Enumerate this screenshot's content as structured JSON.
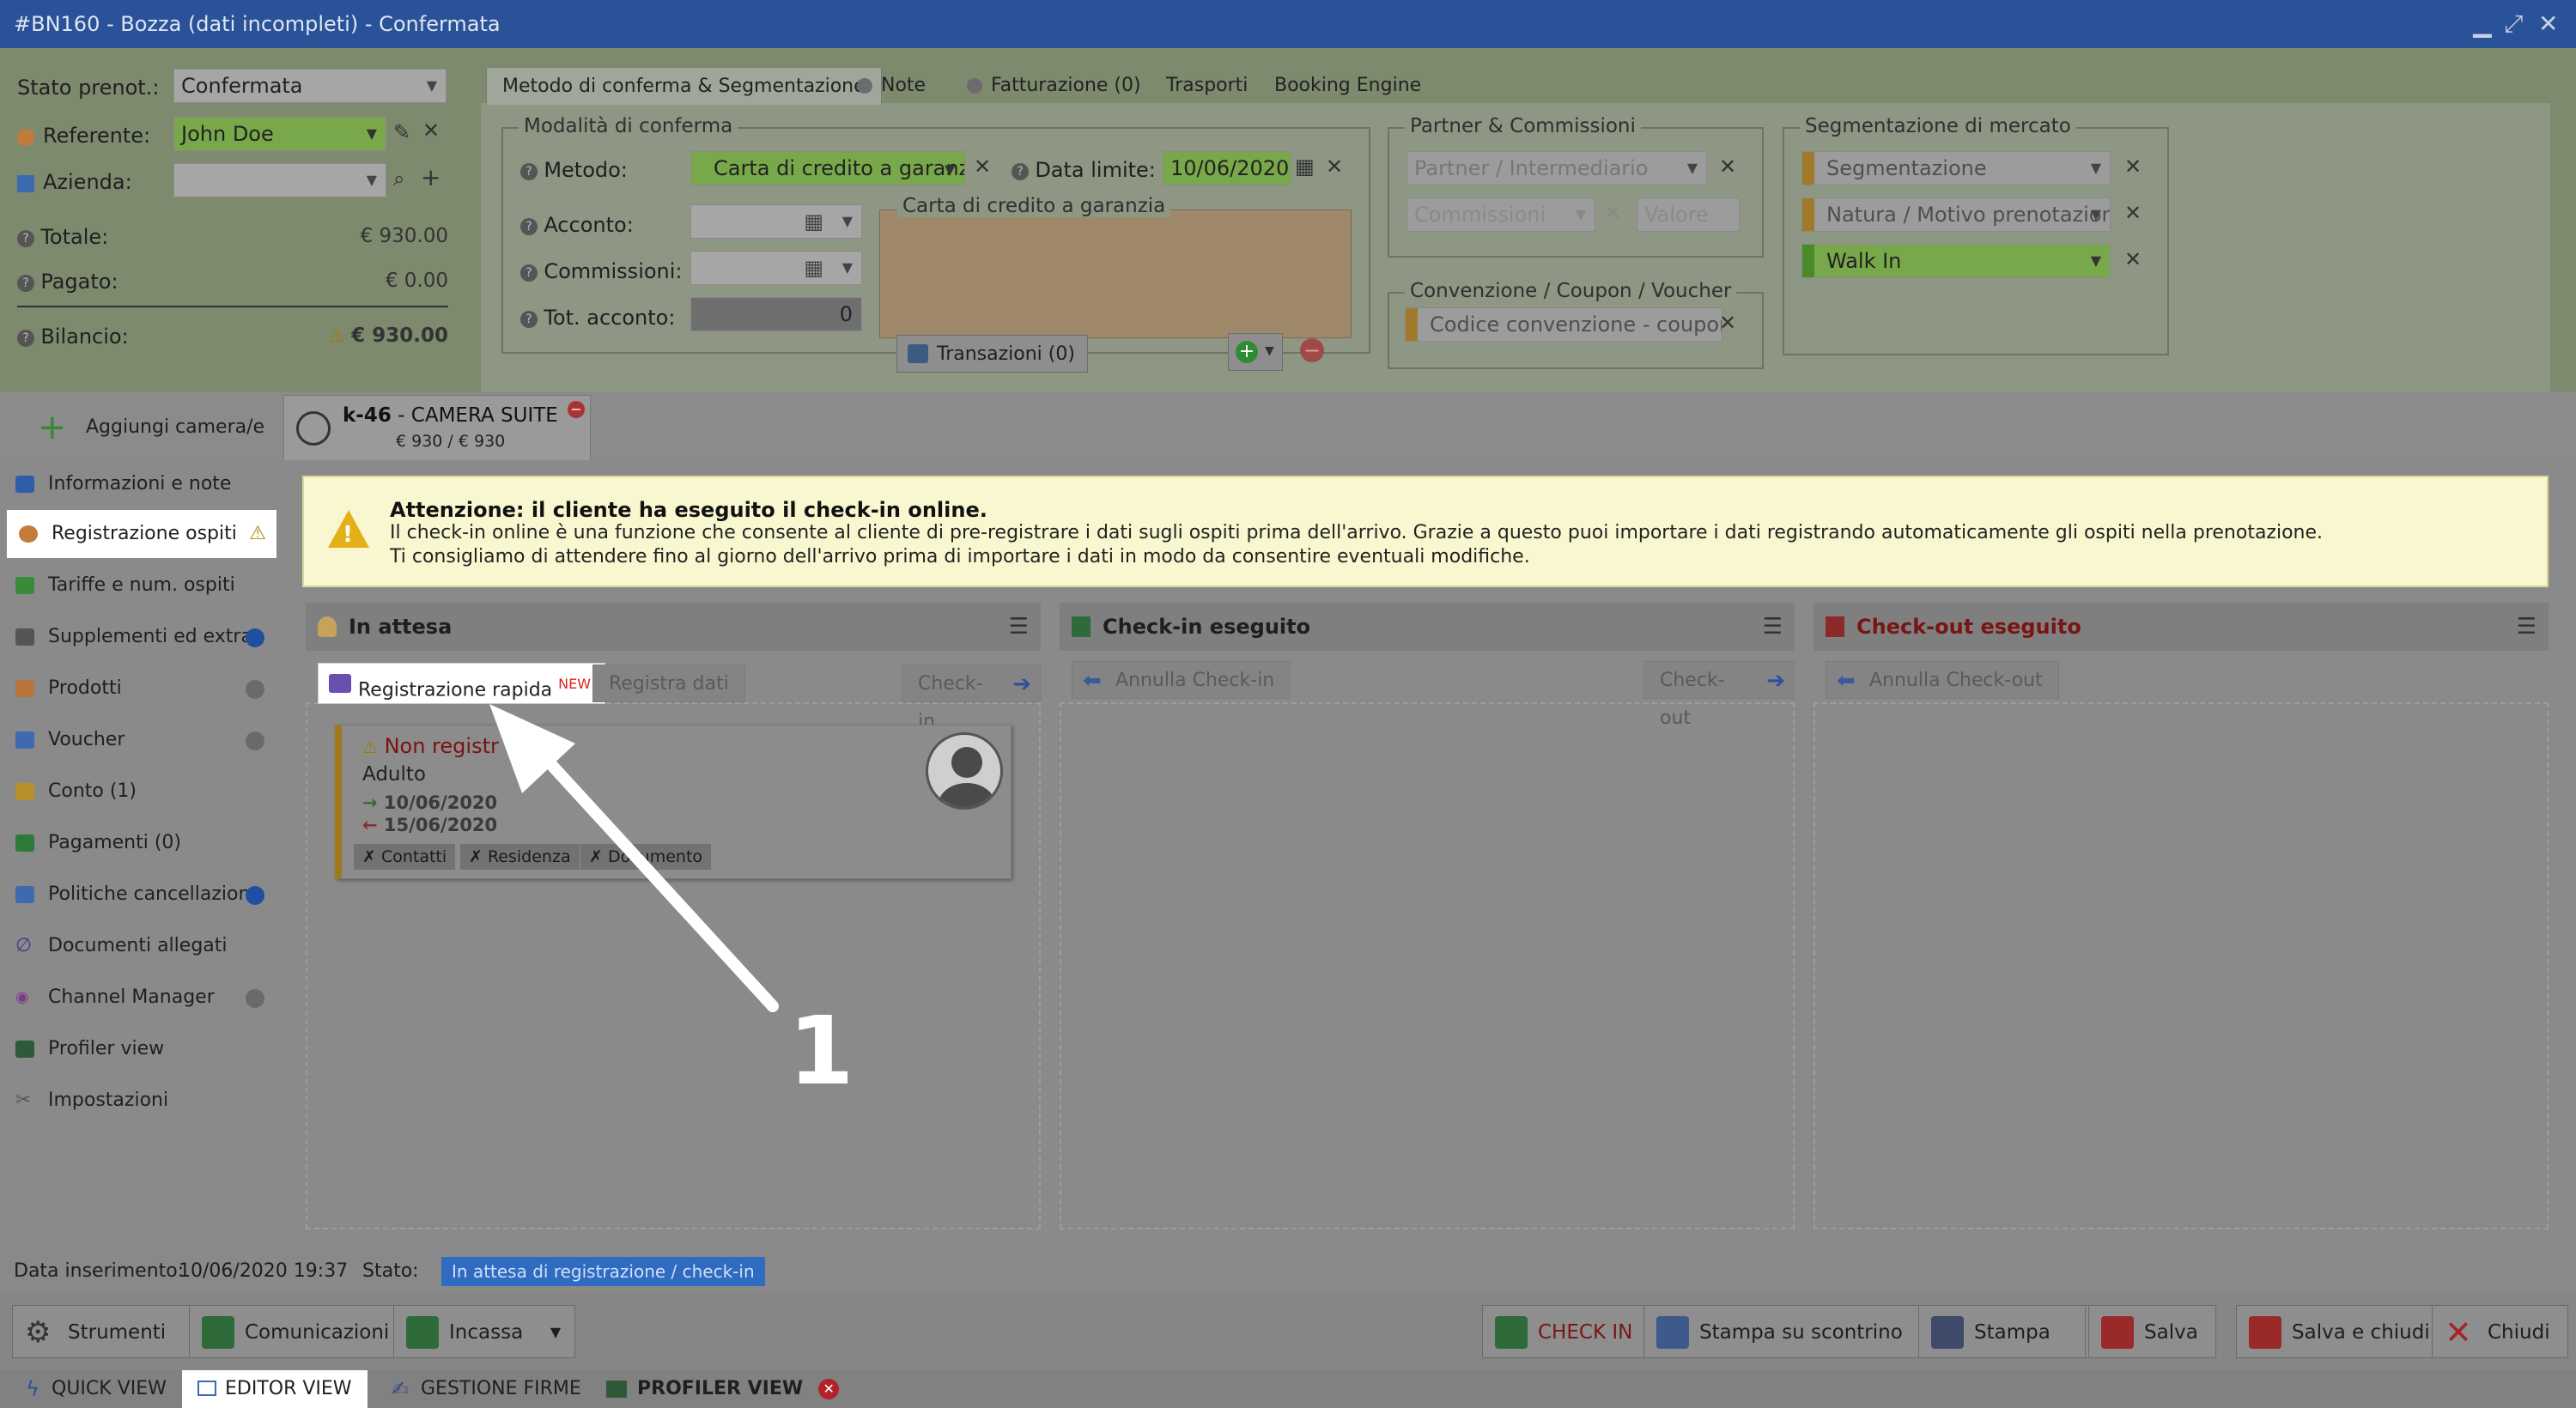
{
  "window": {
    "title": "#BN160 - Bozza (dati incompleti) - Confermata",
    "controls": [
      "minimize-icon",
      "maximize-icon",
      "close-icon"
    ]
  },
  "summary": {
    "stato_label": "Stato prenot.:",
    "stato_value": "Confermata",
    "referente_label": "Referente:",
    "referente_value": "John Doe",
    "azienda_label": "Azienda:",
    "azienda_value": "",
    "totale_label": "Totale:",
    "totale_value": "€ 930.00",
    "pagato_label": "Pagato:",
    "pagato_value": "€ 0.00",
    "bilancio_label": "Bilancio:",
    "bilancio_value": "€ 930.00"
  },
  "tabs": [
    {
      "label": "Metodo di conferma & Segmentazione"
    },
    {
      "label": "Note"
    },
    {
      "label": "Fatturazione (0)"
    },
    {
      "label": "Trasporti"
    },
    {
      "label": "Booking Engine"
    }
  ],
  "conferma": {
    "legend": "Modalità di conferma",
    "metodo_label": "Metodo:",
    "metodo_value": "Carta di credito a garanz",
    "data_limite_label": "Data limite:",
    "data_limite_value": "10/06/2020",
    "acconto_label": "Acconto:",
    "commissioni_label": "Commissioni:",
    "tot_acconto_label": "Tot. acconto:",
    "tot_acconto_value": "0",
    "carta_legend": "Carta di credito a garanzia",
    "transazioni_label": "Transazioni (0)"
  },
  "partner": {
    "legend": "Partner & Commissioni",
    "partner_placeholder": "Partner / Intermediario",
    "commissioni_placeholder": "Commissioni",
    "valore_placeholder": "Valore"
  },
  "convenzione": {
    "legend": "Convenzione / Coupon / Voucher",
    "codice_placeholder": "Codice convenzione - coupon"
  },
  "segmentazione": {
    "legend": "Segmentazione di mercato",
    "segmentazione_placeholder": "Segmentazione",
    "natura_placeholder": "Natura / Motivo prenotazione",
    "walkin_value": "Walk In"
  },
  "room_tab": {
    "add_label": "Aggiungi camera/e",
    "code": "k-46",
    "name": " - CAMERA SUITE",
    "price": "€ 930 / € 930"
  },
  "sidebar": {
    "items": [
      {
        "label": "Informazioni e note"
      },
      {
        "label": "Registrazione ospiti"
      },
      {
        "label": "Tariffe e num. ospiti"
      },
      {
        "label": "Supplementi ed extra"
      },
      {
        "label": "Prodotti"
      },
      {
        "label": "Voucher"
      },
      {
        "label": "Conto (1)"
      },
      {
        "label": "Pagamenti (0)"
      },
      {
        "label": "Politiche cancellazione"
      },
      {
        "label": "Documenti allegati"
      },
      {
        "label": "Channel Manager"
      },
      {
        "label": "Profiler view"
      },
      {
        "label": "Impostazioni"
      }
    ]
  },
  "warning": {
    "title": "Attenzione: il cliente ha eseguito il check-in online.",
    "line1": "Il check-in online è una funzione che consente al cliente di pre-registrare i dati sugli ospiti prima dell'arrivo. Grazie a questo puoi importare i dati registrando automaticamente gli ospiti nella prenotazione.",
    "line2": "Ti consigliamo di attendere fino al giorno dell'arrivo prima di importare i dati in modo da consentire eventuali modifiche."
  },
  "columns": {
    "attesa": {
      "title": "In attesa",
      "registrazione_rapida": "Registrazione rapida",
      "new_badge": "NEW",
      "registra_dati": "Registra dati",
      "checkin": "Check-in"
    },
    "checkin": {
      "title": "Check-in eseguito",
      "annulla": "Annulla Check-in",
      "checkout": "Check-out"
    },
    "checkout": {
      "title": "Check-out eseguito",
      "annulla": "Annulla Check-out"
    }
  },
  "guest_card": {
    "status": "Non registr",
    "type": "Adulto",
    "arrival": "10/06/2020",
    "departure": "15/06/2020",
    "tags": [
      "✗ Contatti",
      "✗ Residenza",
      "✗ Documento"
    ]
  },
  "annotation": {
    "number": "1"
  },
  "footer": {
    "data_label": "Data inserimento:",
    "data_value": "10/06/2020 19:37",
    "stato_label": "Stato:",
    "stato_value": "In attesa di registrazione / check-in"
  },
  "toolbar": {
    "strumenti": "Strumenti",
    "comunicazioni": "Comunicazioni",
    "incassa": "Incassa",
    "checkin": "CHECK IN",
    "stampa_scontrino": "Stampa su scontrino",
    "stampa": "Stampa",
    "salva": "Salva",
    "salva_chiudi": "Salva e chiudi",
    "chiudi": "Chiudi"
  },
  "bottom_tabs": {
    "quick": "QUICK VIEW",
    "editor": "EDITOR VIEW",
    "firme": "GESTIONE FIRME",
    "profiler": "PROFILER VIEW"
  },
  "colors": {
    "titlebar": "#2a5298",
    "accent_red": "#b3222a",
    "status_badge": "#2f6bc0",
    "arrow": "#ffffff"
  }
}
